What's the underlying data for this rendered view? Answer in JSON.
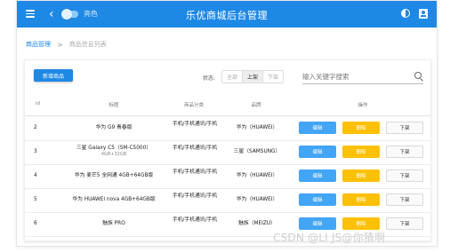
{
  "header": {
    "title": "乐优商城后台管理",
    "theme_label": "亮色",
    "icons": [
      "menu-icon",
      "back-icon",
      "theme-toggle",
      "contrast-icon",
      "account-icon"
    ]
  },
  "breadcrumb": {
    "root": "商品管理",
    "separator": ">",
    "current": "商品信息列表"
  },
  "toolbar": {
    "add_label": "新增商品",
    "status_label": "状态:",
    "status_options": [
      "全部",
      "上架",
      "下架"
    ],
    "status_selected": "上架",
    "search_placeholder": "输入关键字搜索"
  },
  "table": {
    "headers": [
      "id",
      "标题",
      "商品分类",
      "品牌",
      "操作"
    ],
    "rows": [
      {
        "id": "2",
        "title": "华为 G9 青春版",
        "title_sub": "",
        "category": "手机/手机通讯/手机",
        "brand": "华为（HUAWEI）"
      },
      {
        "id": "3",
        "title": "三星 Galaxy C5（SM-C5000）",
        "title_sub": "4GB+32GB",
        "category": "手机/手机通讯/手机",
        "brand": "三星（SAMSUNG）"
      },
      {
        "id": "4",
        "title": "华为 麦芒5 全网通 4GB+64GB版",
        "title_sub": "",
        "category": "手机/手机通讯/手机",
        "brand": "华为（HUAWEI）"
      },
      {
        "id": "5",
        "title": "华为 HUAWEI nova 4GB+64GB版",
        "title_sub": "",
        "category": "手机/手机通讯/手机",
        "brand": "华为（HUAWEI）"
      },
      {
        "id": "6",
        "title": "魅族 PRO",
        "title_sub": "",
        "category": "手机/手机通讯/手机",
        "brand": "魅族（MEIZU）"
      }
    ],
    "actions": {
      "edit": "编辑",
      "delete": "删除",
      "offline": "下架"
    }
  },
  "colors": {
    "primary": "#1e88e5",
    "edit": "#42a5f5",
    "delete": "#ffc107"
  },
  "watermark": "CSDN @LI JS@你猜啊"
}
